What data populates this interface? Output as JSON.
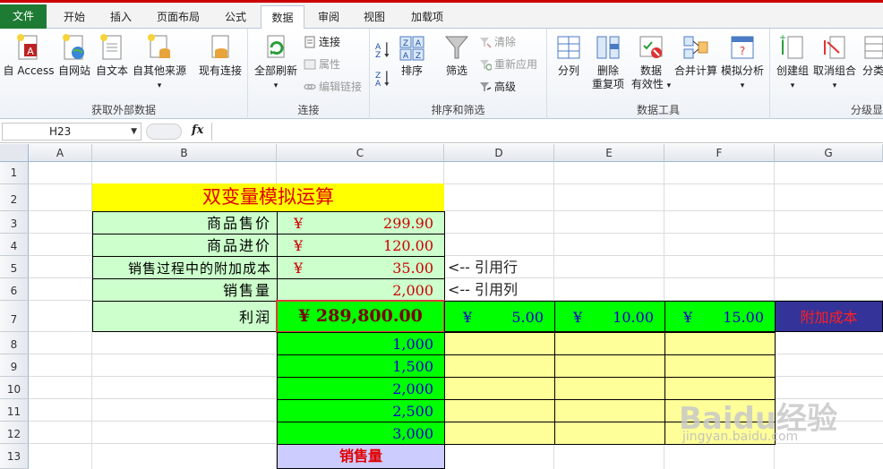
{
  "tabs": [
    "文件",
    "开始",
    "插入",
    "页面布局",
    "公式",
    "数据",
    "审阅",
    "视图",
    "加载项"
  ],
  "ribbon": {
    "get_external": {
      "label": "获取外部数据",
      "access": "自 Access",
      "web": "自网站",
      "text": "自文本",
      "other": "自其他来源",
      "existing": "现有连接"
    },
    "connections": {
      "label": "连接",
      "refresh_all": "全部刷新",
      "connections": "连接",
      "properties": "属性",
      "edit_links": "编辑链接"
    },
    "sort_filter": {
      "label": "排序和筛选",
      "sort": "排序",
      "filter": "筛选",
      "clear": "清除",
      "reapply": "重新应用",
      "advanced": "高级"
    },
    "data_tools": {
      "label": "数据工具",
      "split": "分列",
      "remove_dup_1": "删除",
      "remove_dup_2": "重复项",
      "validation_1": "数据",
      "validation_2": "有效性",
      "consolidate": "合并计算",
      "whatif": "模拟分析"
    },
    "outline": {
      "label": "分级显",
      "group": "创建组",
      "ungroup": "取消组合",
      "subtotal": "分类"
    }
  },
  "formula_bar": {
    "name_box": "H23",
    "fx": "fx",
    "formula": ""
  },
  "columns": [
    "A",
    "B",
    "C",
    "D",
    "E",
    "F",
    "G"
  ],
  "rows": [
    "1",
    "2",
    "3",
    "4",
    "5",
    "6",
    "7",
    "8",
    "9",
    "10",
    "11",
    "12",
    "13"
  ],
  "sheet": {
    "title": "双变量模拟运算",
    "labels": [
      "商品售价",
      "商品进价",
      "销售过程中的附加成本",
      "销售量",
      "利润"
    ],
    "price": {
      "yen": "¥",
      "num": "299.90"
    },
    "cost": {
      "yen": "¥",
      "num": "120.00"
    },
    "extra": {
      "yen": "¥",
      "num": "35.00"
    },
    "qty": "2,000",
    "profit": "¥  289,800.00",
    "ref_row": "<-- 引用行",
    "ref_col": "<-- 引用列",
    "col_values": [
      {
        "yen": "¥",
        "num": "5.00"
      },
      {
        "yen": "¥",
        "num": "10.00"
      },
      {
        "yen": "¥",
        "num": "15.00"
      }
    ],
    "row_values": [
      "1,000",
      "1,500",
      "2,000",
      "2,500",
      "3,000"
    ],
    "extra_cost_label": "附加成本",
    "qty_label": "销售量"
  },
  "watermark": {
    "brand": "Baidu经验",
    "url": "jingyan.baidu.com"
  },
  "colors": {
    "title_bg": "#ffff00",
    "green": "#00ff00",
    "light_green": "#ccffcc",
    "yellow": "#ffff99",
    "navy": "#333399",
    "lavender": "#ccccff",
    "red": "#cc0000"
  }
}
